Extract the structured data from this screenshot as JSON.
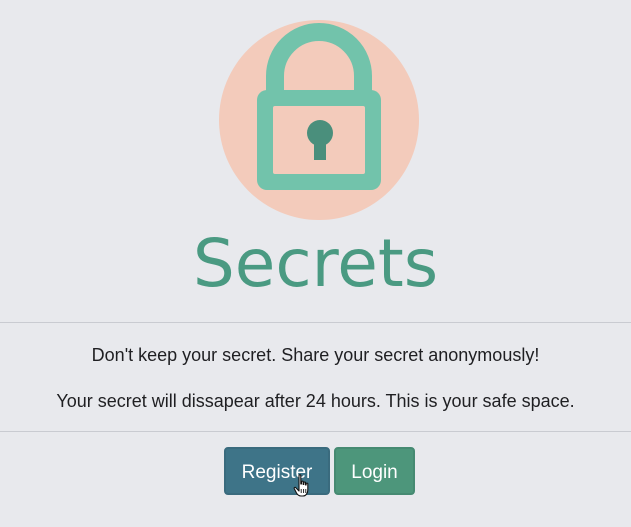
{
  "app": {
    "title": "Secrets"
  },
  "hero": {
    "logo_icon": "lock-icon",
    "circle_color": "#f3cbbb",
    "lock_color": "#72c3ab",
    "keyhole_color": "#4a8f7c"
  },
  "intro": {
    "line1": "Don't keep your secret. Share your secret anonymously!",
    "line2": "Your secret will dissapear after 24 hours. This is your safe space."
  },
  "actions": {
    "register_label": "Register",
    "login_label": "Login"
  },
  "cursor": {
    "icon": "hand-pointer-icon"
  },
  "colors": {
    "background": "#e8e9ed",
    "title": "#4a9a82",
    "register_button": "#3e7488",
    "login_button": "#4d967b"
  }
}
